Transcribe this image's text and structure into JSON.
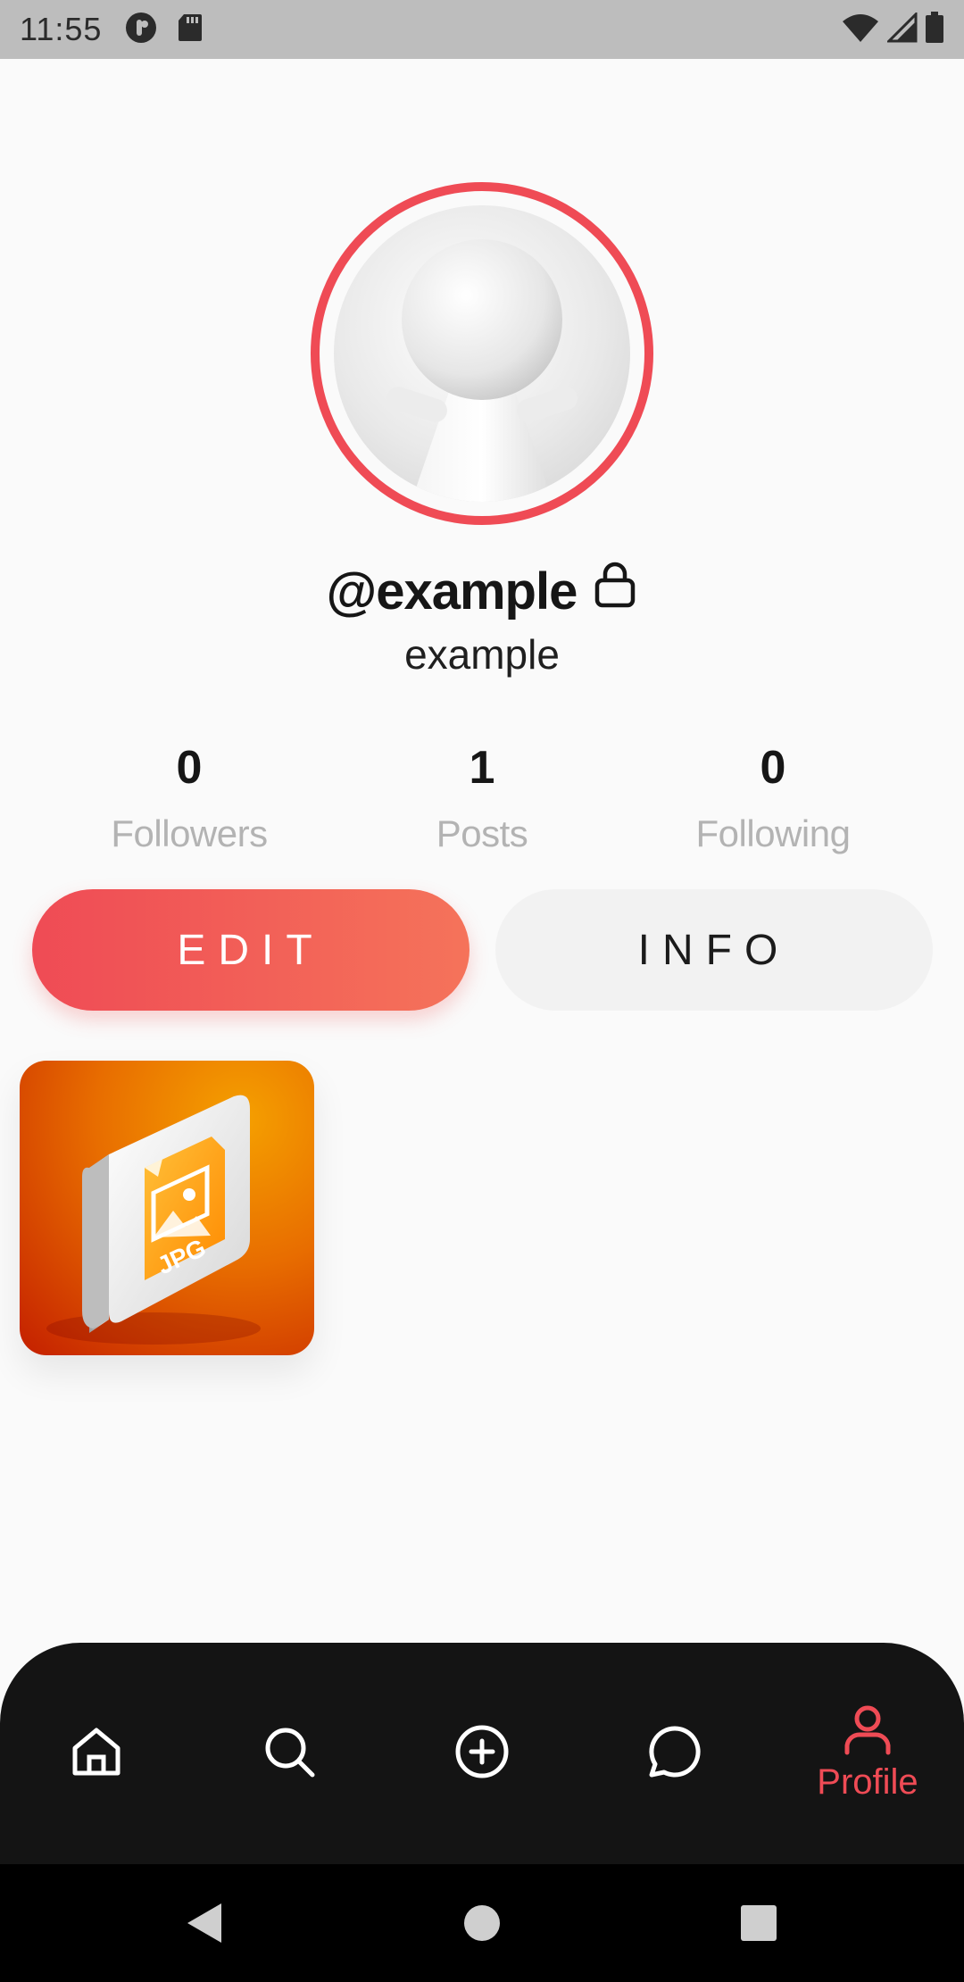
{
  "status_bar": {
    "time": "11:55",
    "left_icons": [
      "podcast-icon",
      "sd-card-icon"
    ],
    "right_icons": [
      "wifi-icon",
      "signal-icon",
      "battery-icon"
    ]
  },
  "profile": {
    "handle": "@example",
    "display_name": "example",
    "private_icon": "lock-icon",
    "ring_color": "#ef4b55"
  },
  "stats": {
    "followers": {
      "value": "0",
      "label": "Followers"
    },
    "posts": {
      "value": "1",
      "label": "Posts"
    },
    "following": {
      "value": "0",
      "label": "Following"
    }
  },
  "buttons": {
    "edit_label": "EDIT",
    "info_label": "INFO"
  },
  "posts": [
    {
      "thumbnail": "jpg-file-icon",
      "label": "JPG"
    }
  ],
  "bottom_nav": {
    "items": [
      {
        "icon": "home-icon",
        "label": ""
      },
      {
        "icon": "search-icon",
        "label": ""
      },
      {
        "icon": "add-circle-icon",
        "label": ""
      },
      {
        "icon": "chat-icon",
        "label": ""
      },
      {
        "icon": "profile-icon",
        "label": "Profile",
        "active": true
      }
    ],
    "active_color": "#ef4b55"
  },
  "system_nav": [
    "back-icon",
    "home-circle-icon",
    "recents-icon"
  ]
}
